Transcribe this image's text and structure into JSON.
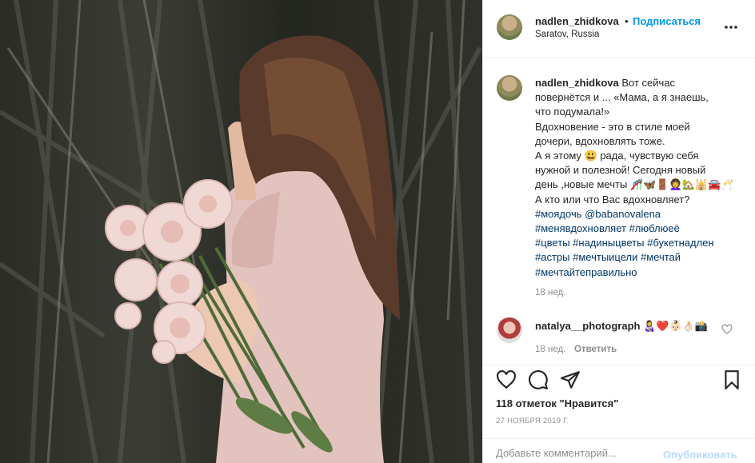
{
  "photo": {
    "alt": ""
  },
  "header": {
    "username": "nadlen_zhidkova",
    "separator": "•",
    "follow_label": "Подписаться",
    "location": "Saratov, Russia",
    "more_icon": "more-horizontal-icon"
  },
  "caption": {
    "username": "nadlen_zhidkova",
    "lines": [
      "Вот сейчас",
      "повернётся и ... «Мама, а я знаешь,",
      "что подумала!»",
      "Вдохновение - это в стиле моей",
      "дочери, вдохновлять тоже.",
      "А я этому 😃 рада, чувствую себя",
      "нужной и полезной!  Сегодня новый",
      "день ,новые мечты 🎢🦋🚪👩‍🦱🏡🕌🚘🥂",
      "А кто или что Вас вдохновляет?"
    ],
    "hashtag_lines": [
      [
        "#моядочь",
        "@babanovalena"
      ],
      [
        "#менявдохновляет",
        "#люблюеё"
      ],
      [
        "#цветы",
        "#надиныцветы",
        "#букетнадлен"
      ],
      [
        "#астры",
        "#мечтыицели",
        "#мечтай"
      ],
      [
        "#мечтайтеправильно"
      ]
    ],
    "time": "18 нед."
  },
  "comment": {
    "username": "natalya__photograph",
    "text": "👩‍🍼❤️👶🏻👌🏻📸",
    "time": "18 нед.",
    "reply_label": "Ответить"
  },
  "actions": {
    "like_icon": "heart-icon",
    "comment_icon": "comment-icon",
    "share_icon": "share-icon",
    "save_icon": "bookmark-icon",
    "likes_text": "118 отметок \"Нравится\"",
    "date": "27 НОЯБРЯ 2019 Г."
  },
  "add_comment": {
    "placeholder": "Добавьте комментарий...",
    "publish_label": "Опубликовать"
  }
}
